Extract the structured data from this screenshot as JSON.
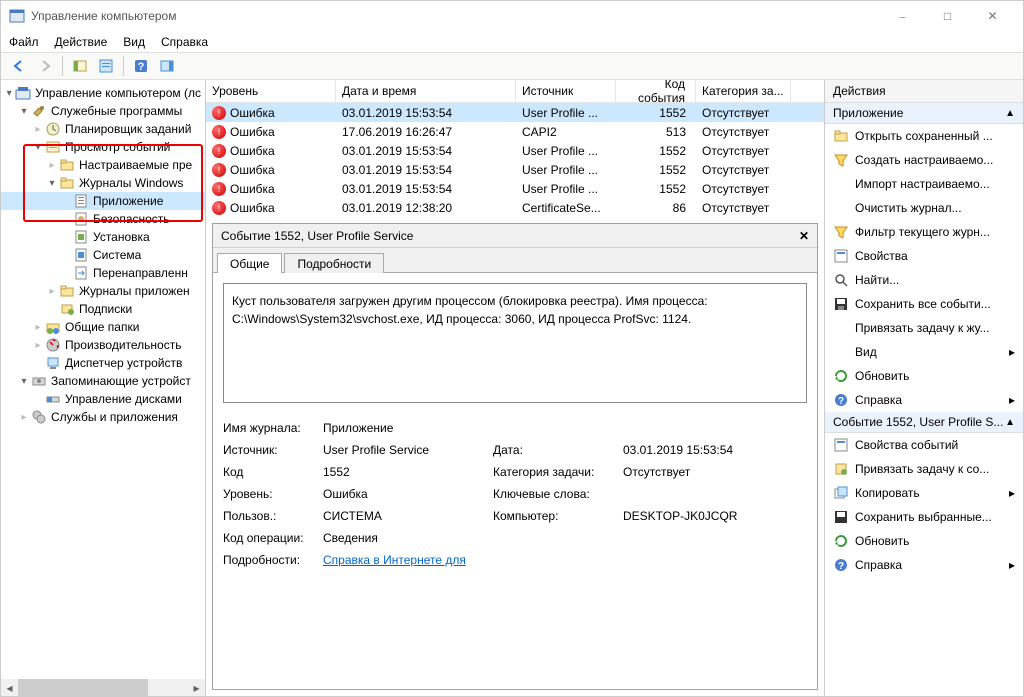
{
  "window": {
    "title": "Управление компьютером"
  },
  "menu": {
    "file": "Файл",
    "action": "Действие",
    "view": "Вид",
    "help": "Справка"
  },
  "tree": {
    "root": "Управление компьютером (лс",
    "tools": "Служебные программы",
    "scheduler": "Планировщик заданий",
    "eventViewer": "Просмотр событий",
    "customViews": "Настраиваемые пре",
    "winLogs": "Журналы Windows",
    "application": "Приложение",
    "security": "Безопасность",
    "setup": "Установка",
    "system": "Система",
    "forwarded": "Перенаправленн",
    "appLogs": "Журналы приложен",
    "subscriptions": "Подписки",
    "sharedFolders": "Общие папки",
    "perf": "Производительность",
    "devmgr": "Диспетчер устройств",
    "storage": "Запоминающие устройст",
    "diskMgmt": "Управление дисками",
    "services": "Службы и приложения"
  },
  "listHeaders": {
    "level": "Уровень",
    "date": "Дата и время",
    "source": "Источник",
    "eventId": "Код события",
    "category": "Категория за..."
  },
  "errorLabel": "Ошибка",
  "events": [
    {
      "date": "03.01.2019 15:53:54",
      "source": "User Profile ...",
      "id": "1552",
      "cat": "Отсутствует",
      "sel": true
    },
    {
      "date": "17.06.2019 16:26:47",
      "source": "CAPI2",
      "id": "513",
      "cat": "Отсутствует"
    },
    {
      "date": "03.01.2019 15:53:54",
      "source": "User Profile ...",
      "id": "1552",
      "cat": "Отсутствует"
    },
    {
      "date": "03.01.2019 15:53:54",
      "source": "User Profile ...",
      "id": "1552",
      "cat": "Отсутствует"
    },
    {
      "date": "03.01.2019 15:53:54",
      "source": "User Profile ...",
      "id": "1552",
      "cat": "Отсутствует"
    },
    {
      "date": "03.01.2019 12:38:20",
      "source": "CertificateSe...",
      "id": "86",
      "cat": "Отсутствует"
    }
  ],
  "detail": {
    "title": "Событие 1552, User Profile Service",
    "tabs": {
      "general": "Общие",
      "details": "Подробности"
    },
    "message": "Куст пользователя загружен другим процессом (блокировка реестра). Имя процесса: C:\\Windows\\System32\\svchost.exe, ИД процесса: 3060, ИД процесса ProfSvc: 1124.",
    "labels": {
      "logName": "Имя журнала:",
      "source": "Источник:",
      "code": "Код",
      "level": "Уровень:",
      "user": "Пользов.:",
      "opcode": "Код операции:",
      "moreInfo": "Подробности:",
      "date": "Дата:",
      "taskCat": "Категория задачи:",
      "keywords": "Ключевые слова:",
      "computer": "Компьютер:"
    },
    "values": {
      "logName": "Приложение",
      "source": "User Profile Service",
      "code": "1552",
      "level": "Ошибка",
      "user": "СИСТЕМА",
      "opcode": "Сведения",
      "date": "03.01.2019 15:53:54",
      "taskCat": "Отсутствует",
      "keywords": "",
      "computer": "DESKTOP-JK0JCQR",
      "link": "Справка в Интернете для"
    }
  },
  "actions": {
    "header": "Действия",
    "section1": "Приложение",
    "items1": [
      "Открыть сохраненный ...",
      "Создать настраиваемо...",
      "Импорт настраиваемо...",
      "Очистить журнал...",
      "Фильтр текущего журн...",
      "Свойства",
      "Найти...",
      "Сохранить все событи...",
      "Привязать задачу к жу...",
      "Вид",
      "Обновить",
      "Справка"
    ],
    "section2": "Событие 1552, User Profile S...",
    "items2": [
      "Свойства событий",
      "Привязать задачу к со...",
      "Копировать",
      "Сохранить выбранные...",
      "Обновить",
      "Справка"
    ]
  }
}
